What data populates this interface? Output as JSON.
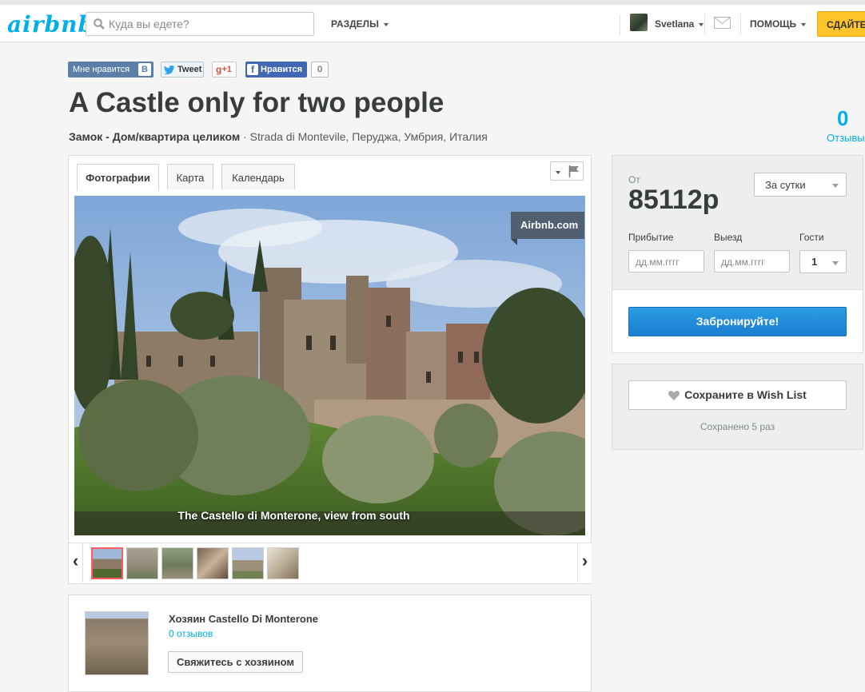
{
  "header": {
    "logo": "airbnb",
    "search_placeholder": "Куда вы едете?",
    "sections_label": "РАЗДЕЛЫ",
    "user_name": "Svetlana",
    "help_label": "ПОМОЩЬ",
    "list_label": "СДАЙТЕ",
    "icons": [
      "search-icon",
      "envelope-icon",
      "avatar"
    ]
  },
  "social": {
    "vk_label": "Мне нравится",
    "vk_badge": "В",
    "tweet_label": "Tweet",
    "gplus_label": "+1",
    "fb_label": "Нравится",
    "fb_count": "0"
  },
  "listing": {
    "title": "A Castle only for two people",
    "type": "Замок - Дом/квартира целиком",
    "address": "Strada di Montevile, Перуджа, Умбрия, Италия",
    "reviews_count": "0",
    "reviews_label": "Отзывы"
  },
  "tabs": [
    {
      "label": "Фотографии",
      "active": true
    },
    {
      "label": "Карта",
      "active": false
    },
    {
      "label": "Календарь",
      "active": false
    }
  ],
  "photo": {
    "watermark": "Airbnb.com",
    "caption": "The Castello di Monterone, view from south",
    "thumbnail_count": 6,
    "selected_thumbnail": 1
  },
  "host": {
    "name": "Хозяин Castello Di Monterone",
    "reviews": "0 отзывов",
    "contact_label": "Свяжитесь с хозяином"
  },
  "booking": {
    "from_label": "От",
    "price": "85112р",
    "period": "За сутки",
    "checkin_label": "Прибытие",
    "checkout_label": "Выезд",
    "guests_label": "Гости",
    "date_placeholder": "дд.мм.гггг",
    "guests_value": "1",
    "book_label": "Забронируйте!"
  },
  "wishlist": {
    "label": "Сохраните в Wish List",
    "saved_text": "Сохранено 5 раз"
  },
  "colors": {
    "brand": "#00aee8",
    "book_button": "#1b7fd0",
    "list_button": "#ffc42a",
    "selected_thumb": "#ff5a5f"
  }
}
